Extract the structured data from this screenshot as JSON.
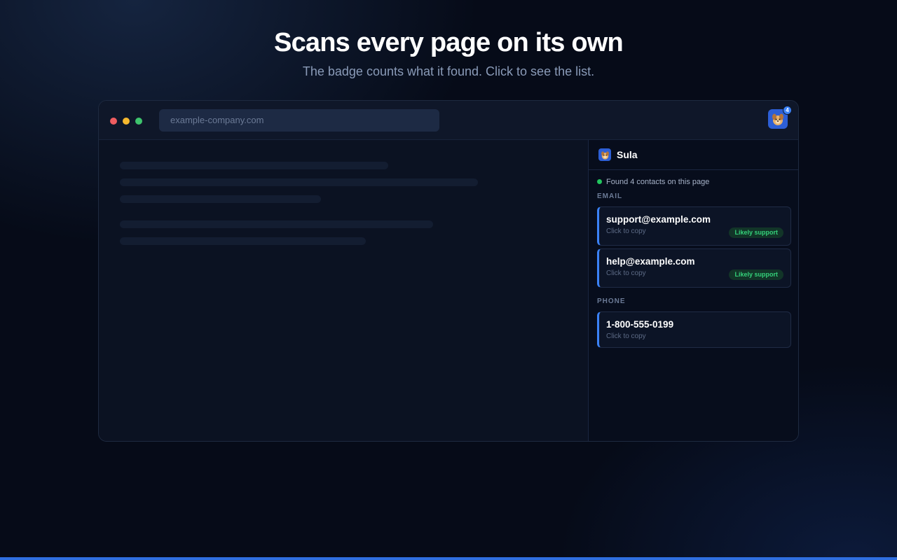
{
  "hero": {
    "title": "Scans every page on its own",
    "subtitle": "The badge counts what it found. Click to see the list."
  },
  "browser": {
    "url_placeholder": "example-company.com",
    "extension": {
      "icon": "dog-mascot-icon",
      "badge_count": "4"
    }
  },
  "panel": {
    "title": "Sula",
    "status": "Found 4 contacts on this page",
    "sections": [
      {
        "label": "EMAIL",
        "items": [
          {
            "value": "support@example.com",
            "hint": "Click to copy",
            "tag": "Likely support"
          },
          {
            "value": "help@example.com",
            "hint": "Click to copy",
            "tag": "Likely support"
          }
        ]
      },
      {
        "label": "PHONE",
        "items": [
          {
            "value": "1-800-555-0199",
            "hint": "Click to copy",
            "tag": ""
          }
        ]
      }
    ]
  },
  "colors": {
    "traffic_red": "#ef5d60",
    "traffic_yellow": "#f5b82e",
    "traffic_green": "#3ec46d",
    "accent": "#3b82f6",
    "status_green": "#22c55e",
    "tag_text": "#34d17a"
  }
}
